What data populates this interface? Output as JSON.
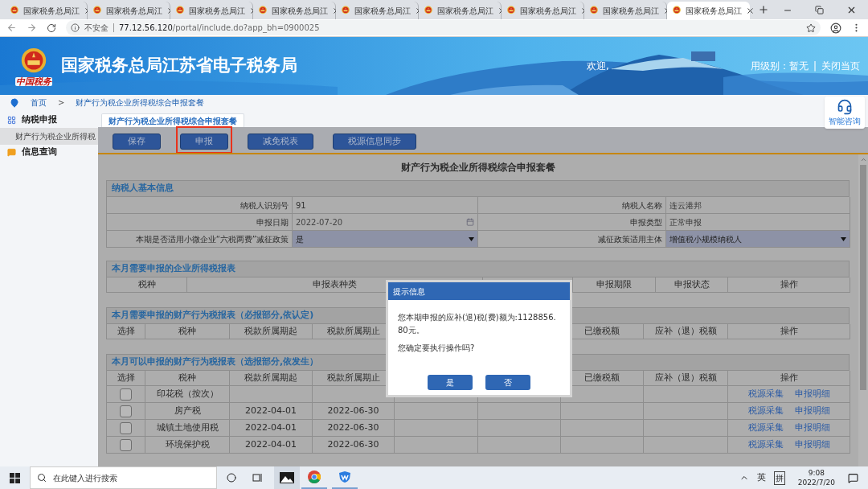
{
  "browser": {
    "tabs": [
      {
        "title": "国家税务总局江",
        "selected": false
      },
      {
        "title": "国家税务总局江",
        "selected": false
      },
      {
        "title": "国家税务总局江",
        "selected": false
      },
      {
        "title": "国家税务总局江",
        "selected": false
      },
      {
        "title": "国家税务总局江",
        "selected": false
      },
      {
        "title": "国家税务总局江",
        "selected": false
      },
      {
        "title": "国家税务总局江",
        "selected": false
      },
      {
        "title": "国家税务总局江",
        "selected": false
      },
      {
        "title": "国家税务总局江",
        "selected": true
      }
    ],
    "address": {
      "security": "不安全",
      "host": "77.12.56.120",
      "path": "/portal/include.do?app_bh=0900025"
    }
  },
  "banner": {
    "logo_text": "中国税务",
    "title": "国家税务总局江苏省电子税务局",
    "welcome": "欢迎,",
    "credit": "用级别：暂无",
    "separator": "|",
    "close": "关闭当页"
  },
  "consult": {
    "label": "智能咨询"
  },
  "breadcrumb": {
    "items": [
      "首页",
      "财产行为税企业所得税综合申报套餐"
    ],
    "separator": ">"
  },
  "sidebar": [
    {
      "label": "纳税申报",
      "children": [
        {
          "label": "财产行为税企业所得税",
          "selected": true
        }
      ]
    },
    {
      "label": "信息查询"
    }
  ],
  "main": {
    "tab": {
      "label": "财产行为税企业所得税综合申报套餐",
      "selected": true
    },
    "toolbar": [
      {
        "label": "保存",
        "highlighted": false
      },
      {
        "label": "申报",
        "highlighted": true
      },
      {
        "label": "减免税表",
        "highlighted": false
      },
      {
        "label": "税源信息同步",
        "highlighted": false
      }
    ],
    "title": "财产行为税企业所得税综合申报套餐",
    "basic_info": {
      "title": "纳税人基本信息",
      "rows": [
        [
          {
            "label": "纳税人识别号",
            "value": "91",
            "kind": "text"
          },
          {
            "label": "纳税人名称",
            "value": "连云港邦",
            "kind": "text"
          }
        ],
        [
          {
            "label": "申报日期",
            "value": "2022-07-20",
            "kind": "date"
          },
          {
            "label": "申报类型",
            "value": "正常申报",
            "kind": "text"
          }
        ],
        [
          {
            "label": "本期是否适用小微企业“六税两费”减征政策",
            "value": "是",
            "kind": "select"
          },
          {
            "label": "减征政策适用主体",
            "value": "增值税小规模纳税人",
            "kind": "select"
          }
        ]
      ]
    },
    "sections": [
      {
        "title": "本月需要申报的企业所得税报表",
        "columns": [
          "税种",
          "申报表种类",
          "申报期限",
          "申报状态",
          "操作"
        ]
      },
      {
        "title": "本月需要申报的财产行为税报表（必报部分,依认定)",
        "columns": [
          "选择",
          "税种",
          "税款所属期起",
          "税款所属期止",
          "已缴税额",
          "应补（退）税额",
          "操作"
        ]
      },
      {
        "title": "本月可以申报的财产行为税报表（选报部分,依发生）",
        "columns": [
          "选择",
          "税种",
          "税款所属期起",
          "税款所属期止",
          "已缴税额",
          "应补（退）税额",
          "操作"
        ],
        "rows": [
          {
            "tax": "印花税（按次）",
            "checked": false,
            "actions": [
              "税源采集",
              "申报明细"
            ]
          },
          {
            "tax": "房产税",
            "start": "2022-04-01",
            "end": "2022-06-30",
            "checked": false,
            "actions": [
              "税源采集",
              "申报明细"
            ]
          },
          {
            "tax": "城镇土地使用税",
            "start": "2022-04-01",
            "end": "2022-06-30",
            "checked": false,
            "actions": [
              "税源采集",
              "申报明细"
            ]
          },
          {
            "tax": "环境保护税",
            "start": "2022-04-01",
            "end": "2022-06-30",
            "checked": false,
            "actions": [
              "税源采集",
              "申报明细"
            ]
          }
        ]
      }
    ]
  },
  "dialog": {
    "title": "提示信息",
    "message": [
      "您本期申报的应补(退)税(费)额为:1128856.80元。",
      "您确定要执行操作吗?"
    ],
    "buttons": [
      "是",
      "否"
    ]
  },
  "taskbar": {
    "search_placeholder": "在此键入进行搜索",
    "ime": "英",
    "ime_mode": "拼",
    "time": "9:08",
    "date": "2022/7/20"
  }
}
